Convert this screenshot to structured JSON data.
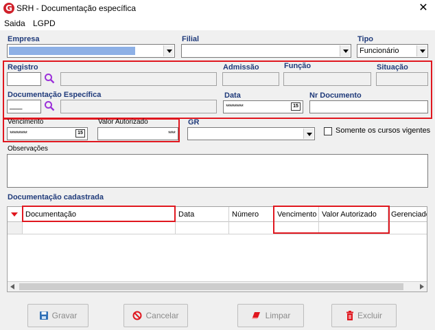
{
  "window": {
    "title": "SRH - Documentação específica",
    "app_icon_letter": "G"
  },
  "menu": {
    "items": [
      "Saida",
      "LGPD"
    ]
  },
  "header_fields": {
    "empresa_label": "Empresa",
    "filial_label": "Filial",
    "tipo_label": "Tipo",
    "tipo_value": "Funcionário"
  },
  "section1": {
    "registro_label": "Registro",
    "admissao_label": "Admissão",
    "funcao_label": "Função",
    "situacao_label": "Situação",
    "doc_especifica_label": "Documentação Específica",
    "doc_code_value": "___",
    "data_label": "Data",
    "data_value": "**********",
    "nr_documento_label": "Nr Documento"
  },
  "section2": {
    "vencimento_label": "Vencimento",
    "vencimento_value": "**********",
    "valor_autorizado_label": "Valor Autorizado",
    "valor_autorizado_value": "****",
    "gr_label": "GR",
    "somente_cursos_label": "Somente os cursos vigentes"
  },
  "observacoes_label": "Observações",
  "grid": {
    "title": "Documentação cadastrada",
    "columns": [
      "Documentação",
      "Data",
      "Número",
      "Vencimento",
      "Valor Autorizado",
      "Gerenciado"
    ]
  },
  "calendar_icon_text": "15",
  "buttons": {
    "gravar": "Gravar",
    "cancelar": "Cancelar",
    "limpar": "Limpar",
    "excluir": "Excluir"
  },
  "colors": {
    "accent_red": "#e0161e",
    "label_blue": "#1f3a7a",
    "masked_blue": "#2f6fd1"
  }
}
